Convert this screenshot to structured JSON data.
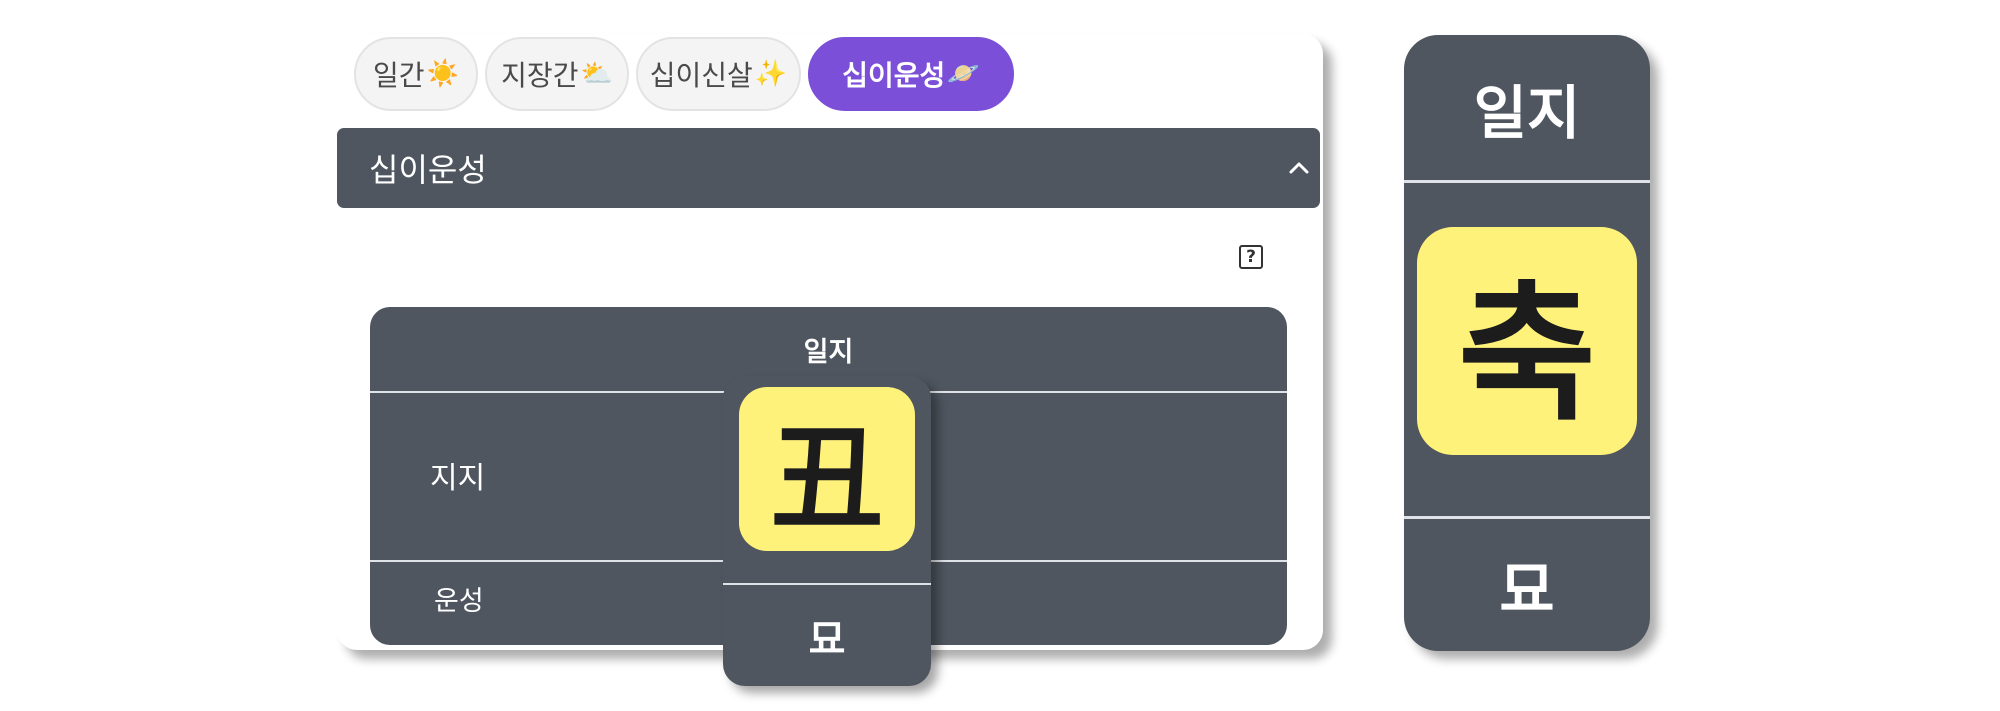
{
  "tabs": [
    {
      "label": "일간",
      "emoji": "☀️",
      "active": false
    },
    {
      "label": "지장간",
      "emoji": "⛅",
      "active": false
    },
    {
      "label": "십이신살",
      "emoji": "✨",
      "active": false
    },
    {
      "label": "십이운성",
      "emoji": "🪐",
      "active": true
    }
  ],
  "section": {
    "title": "십이운성"
  },
  "help": {
    "glyph": "?"
  },
  "table": {
    "column_header": "일지",
    "rows": [
      {
        "label": "지지"
      },
      {
        "label": "운성"
      }
    ]
  },
  "popup": {
    "hanja": "丑",
    "value": "묘"
  },
  "side_card": {
    "header": "일지",
    "reading": "축",
    "value": "묘"
  },
  "colors": {
    "panel": "#4f5660",
    "accent": "#7b4fd8",
    "tile": "#fff27a"
  }
}
